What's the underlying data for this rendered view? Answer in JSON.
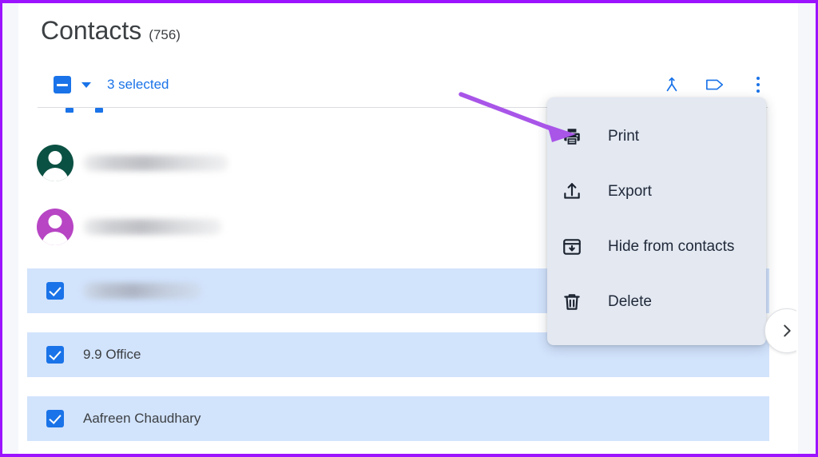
{
  "window": {
    "border_color": "#9B13FF",
    "app_background": "#ffffff"
  },
  "header": {
    "title": "Contacts",
    "count_label": "(756)"
  },
  "selection_bar": {
    "checkbox_state": "indeterminate",
    "dropdown_icon": "caret-down-icon",
    "selected_label": "3 selected",
    "accent_color": "#1a73e8",
    "actions": [
      {
        "name": "merge-icon",
        "tooltip": "Merge and fix"
      },
      {
        "name": "label-icon",
        "tooltip": "Manage labels"
      },
      {
        "name": "more-options-icon",
        "tooltip": "More actions"
      }
    ]
  },
  "contact_list": {
    "rows": [
      {
        "name": "",
        "redacted": true,
        "selected": false,
        "avatar_color": "#0B5143",
        "leading": "avatar",
        "blur_width": 182
      },
      {
        "name": "",
        "redacted": true,
        "selected": false,
        "avatar_color": "#B745C4",
        "leading": "avatar",
        "blur_width": 174
      },
      {
        "name": "",
        "redacted": true,
        "selected": true,
        "leading": "checkbox",
        "blur_width": 148
      },
      {
        "name": "9.9 Office",
        "redacted": false,
        "selected": true,
        "leading": "checkbox"
      },
      {
        "name": "Aafreen Chaudhary",
        "redacted": false,
        "selected": true,
        "leading": "checkbox"
      }
    ],
    "selected_row_color": "#d2e3fc"
  },
  "overflow_menu": {
    "background": "#e3e8f1",
    "items": [
      {
        "label": "Print",
        "icon": "print-icon"
      },
      {
        "label": "Export",
        "icon": "export-icon"
      },
      {
        "label": "Hide from contacts",
        "icon": "hide-from-contacts-icon"
      },
      {
        "label": "Delete",
        "icon": "delete-icon"
      }
    ]
  },
  "next_button": {
    "icon": "chevron-right-icon"
  },
  "annotation": {
    "type": "arrow",
    "color": "#A855E8",
    "points_to": "Print"
  }
}
